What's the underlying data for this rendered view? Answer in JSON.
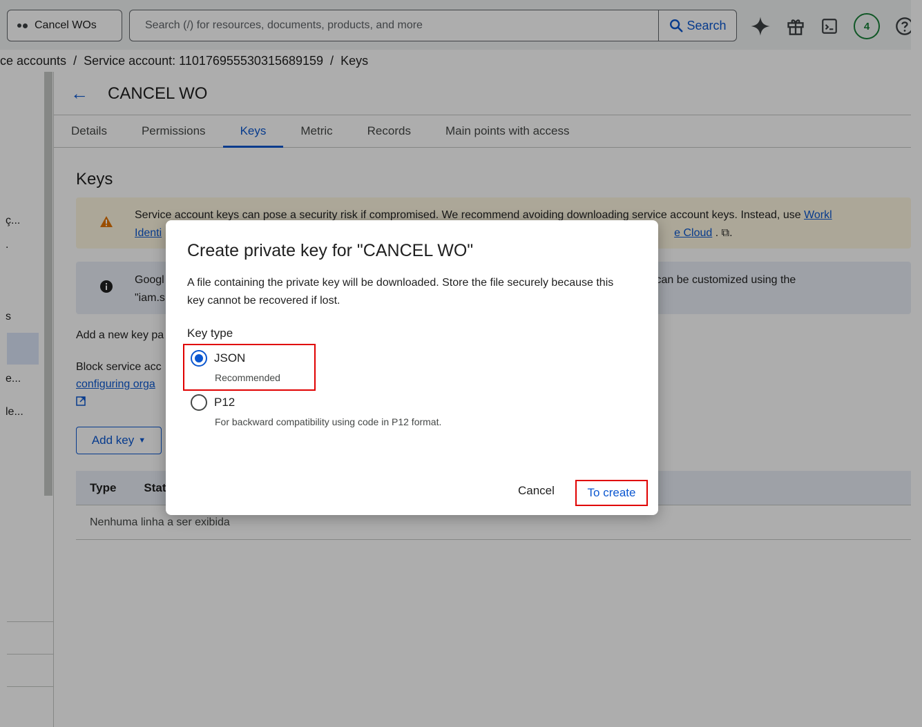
{
  "topbar": {
    "project_label": "Cancel WOs",
    "search_placeholder": "Search (/) for resources, documents, products, and more",
    "search_button": "Search",
    "notification_count": "4"
  },
  "breadcrumb": {
    "items": [
      "ce accounts",
      "/",
      "Service account: 110176955530315689159",
      "/",
      "Keys"
    ]
  },
  "sidebar": {
    "truncated_labels": [
      "ç...",
      ".",
      "s",
      "e...",
      "le..."
    ]
  },
  "header": {
    "title": "CANCEL WO"
  },
  "tabs": [
    "Details",
    "Permissions",
    "Keys",
    "Metric",
    "Records",
    "Main points with access"
  ],
  "keys_section": {
    "title": "Keys",
    "warning_line1_prefix": "Service account keys can pose a security risk if compromised. We recommend avoiding downloading service account keys. Instead, use ",
    "warning_line1_link": "Workl",
    "warning_line2_link1": "Identi",
    "warning_line2_link2": "e Cloud",
    "warning_line2_suffix": ". ⧉.",
    "info_line1_left": "Googl",
    "info_line1_right": "r can be customized using the",
    "info_line2_left": "\"iam.s",
    "add_new_line": "Add a new key pa",
    "block_line": "Block service acc",
    "block_link": "configuring orga",
    "add_key_label": "Add key",
    "table_headers": [
      "Type",
      "Stat"
    ],
    "table_empty": "Nenhuma linha a ser exibida"
  },
  "dialog": {
    "title": "Create private key for \"CANCEL WO\"",
    "description": "A file containing the private key will be downloaded. Store the file securely because this key cannot be recovered if lost.",
    "key_type_label": "Key type",
    "options": [
      {
        "label": "JSON",
        "sub": "Recommended",
        "selected": true
      },
      {
        "label": "P12",
        "sub": "For backward compatibility using code in P12 format.",
        "selected": false
      }
    ],
    "cancel_label": "Cancel",
    "create_label": "To create"
  },
  "colors": {
    "accent": "#0b57d0",
    "highlight": "#e00000",
    "warning_bg": "#fef7e0",
    "info_bg": "#e9eef6"
  }
}
